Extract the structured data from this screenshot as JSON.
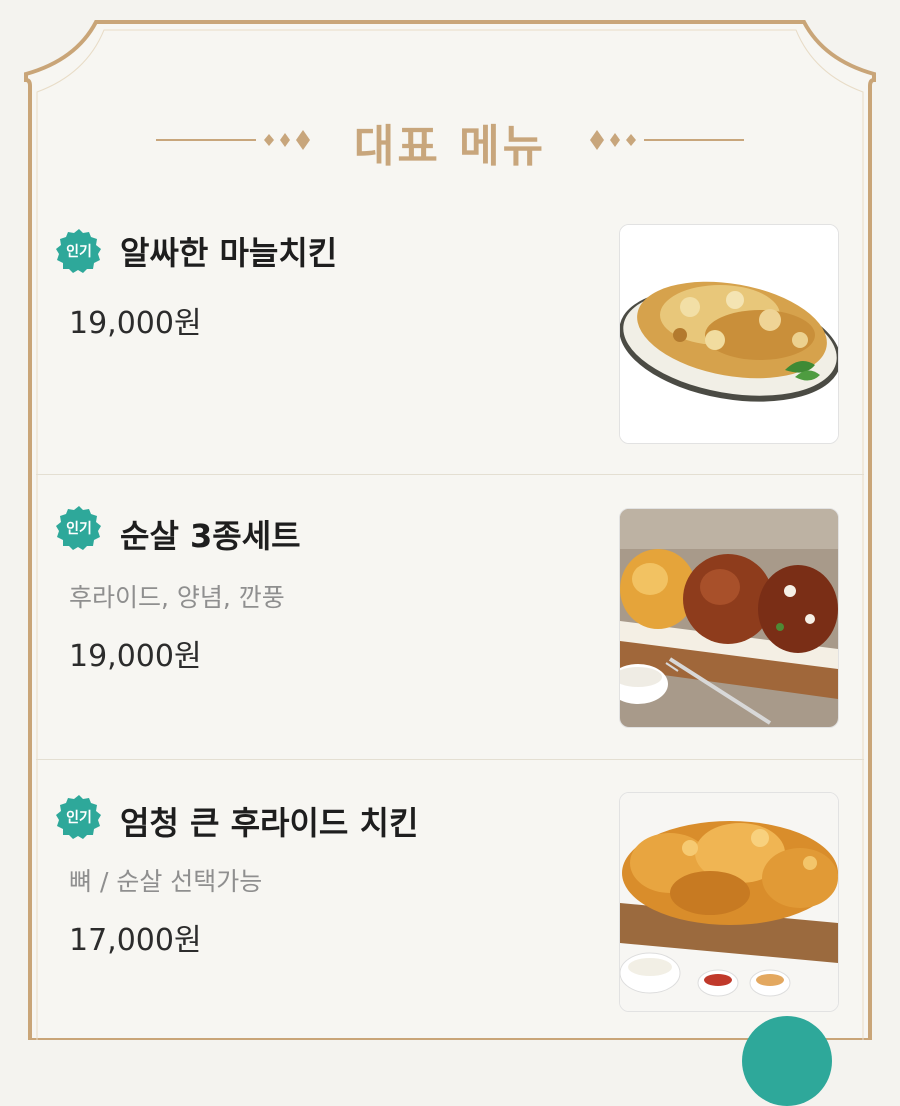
{
  "section": {
    "title": "대표 메뉴"
  },
  "menu_items": [
    {
      "badge": "인기",
      "name": "알싸한 마늘치킨",
      "price": "19,000원",
      "image_icon": "garlic-chicken-photo"
    },
    {
      "badge": "인기",
      "name": "순살 3종세트",
      "description": "후라이드, 양념, 깐풍",
      "price": "19,000원",
      "image_icon": "boneless-combo-photo"
    },
    {
      "badge": "인기",
      "name": "엄청 큰 후라이드 치킨",
      "description": "뼈 / 순살 선택가능",
      "price": "17,000원",
      "image_icon": "fried-chicken-photo"
    }
  ],
  "colors": {
    "accent_gold": "#c8a67c",
    "frame_border": "#c9a578",
    "badge_teal": "#2ea89a",
    "background": "#f4f3ef"
  }
}
